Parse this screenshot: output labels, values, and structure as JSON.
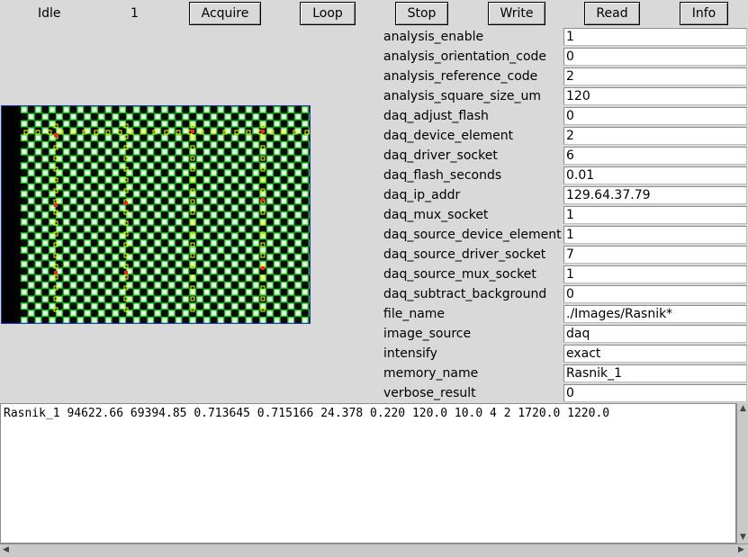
{
  "toolbar": {
    "status": "Idle",
    "counter": "1",
    "acquire_label": "Acquire",
    "loop_label": "Loop",
    "stop_label": "Stop",
    "write_label": "Write",
    "read_label": "Read",
    "info_label": "Info"
  },
  "params": [
    {
      "name": "analysis_enable",
      "value": "1"
    },
    {
      "name": "analysis_orientation_code",
      "value": "0"
    },
    {
      "name": "analysis_reference_code",
      "value": "2"
    },
    {
      "name": "analysis_square_size_um",
      "value": "120"
    },
    {
      "name": "daq_adjust_flash",
      "value": "0"
    },
    {
      "name": "daq_device_element",
      "value": "2"
    },
    {
      "name": "daq_driver_socket",
      "value": "6"
    },
    {
      "name": "daq_flash_seconds",
      "value": "0.01"
    },
    {
      "name": "daq_ip_addr",
      "value": "129.64.37.79"
    },
    {
      "name": "daq_mux_socket",
      "value": "1"
    },
    {
      "name": "daq_source_device_element",
      "value": "1"
    },
    {
      "name": "daq_source_driver_socket",
      "value": "7"
    },
    {
      "name": "daq_source_mux_socket",
      "value": "1"
    },
    {
      "name": "daq_subtract_background",
      "value": "0"
    },
    {
      "name": "file_name",
      "value": "./Images/Rasnik*"
    },
    {
      "name": "image_source",
      "value": "daq"
    },
    {
      "name": "intensify",
      "value": "exact"
    },
    {
      "name": "memory_name",
      "value": "Rasnik_1"
    },
    {
      "name": "verbose_result",
      "value": "0"
    }
  ],
  "result": {
    "text": "Rasnik_1 94622.66 69394.85 0.713645 0.715166 24.378 0.220 120.0 10.0 4 2 1720.0 1220.0"
  },
  "colors": {
    "background": "#d9d9d9",
    "overlay_green": "#22cc22",
    "marker_yellow": "#ffff00",
    "marker_red": "#ff2020",
    "image_border": "#2233cc"
  }
}
